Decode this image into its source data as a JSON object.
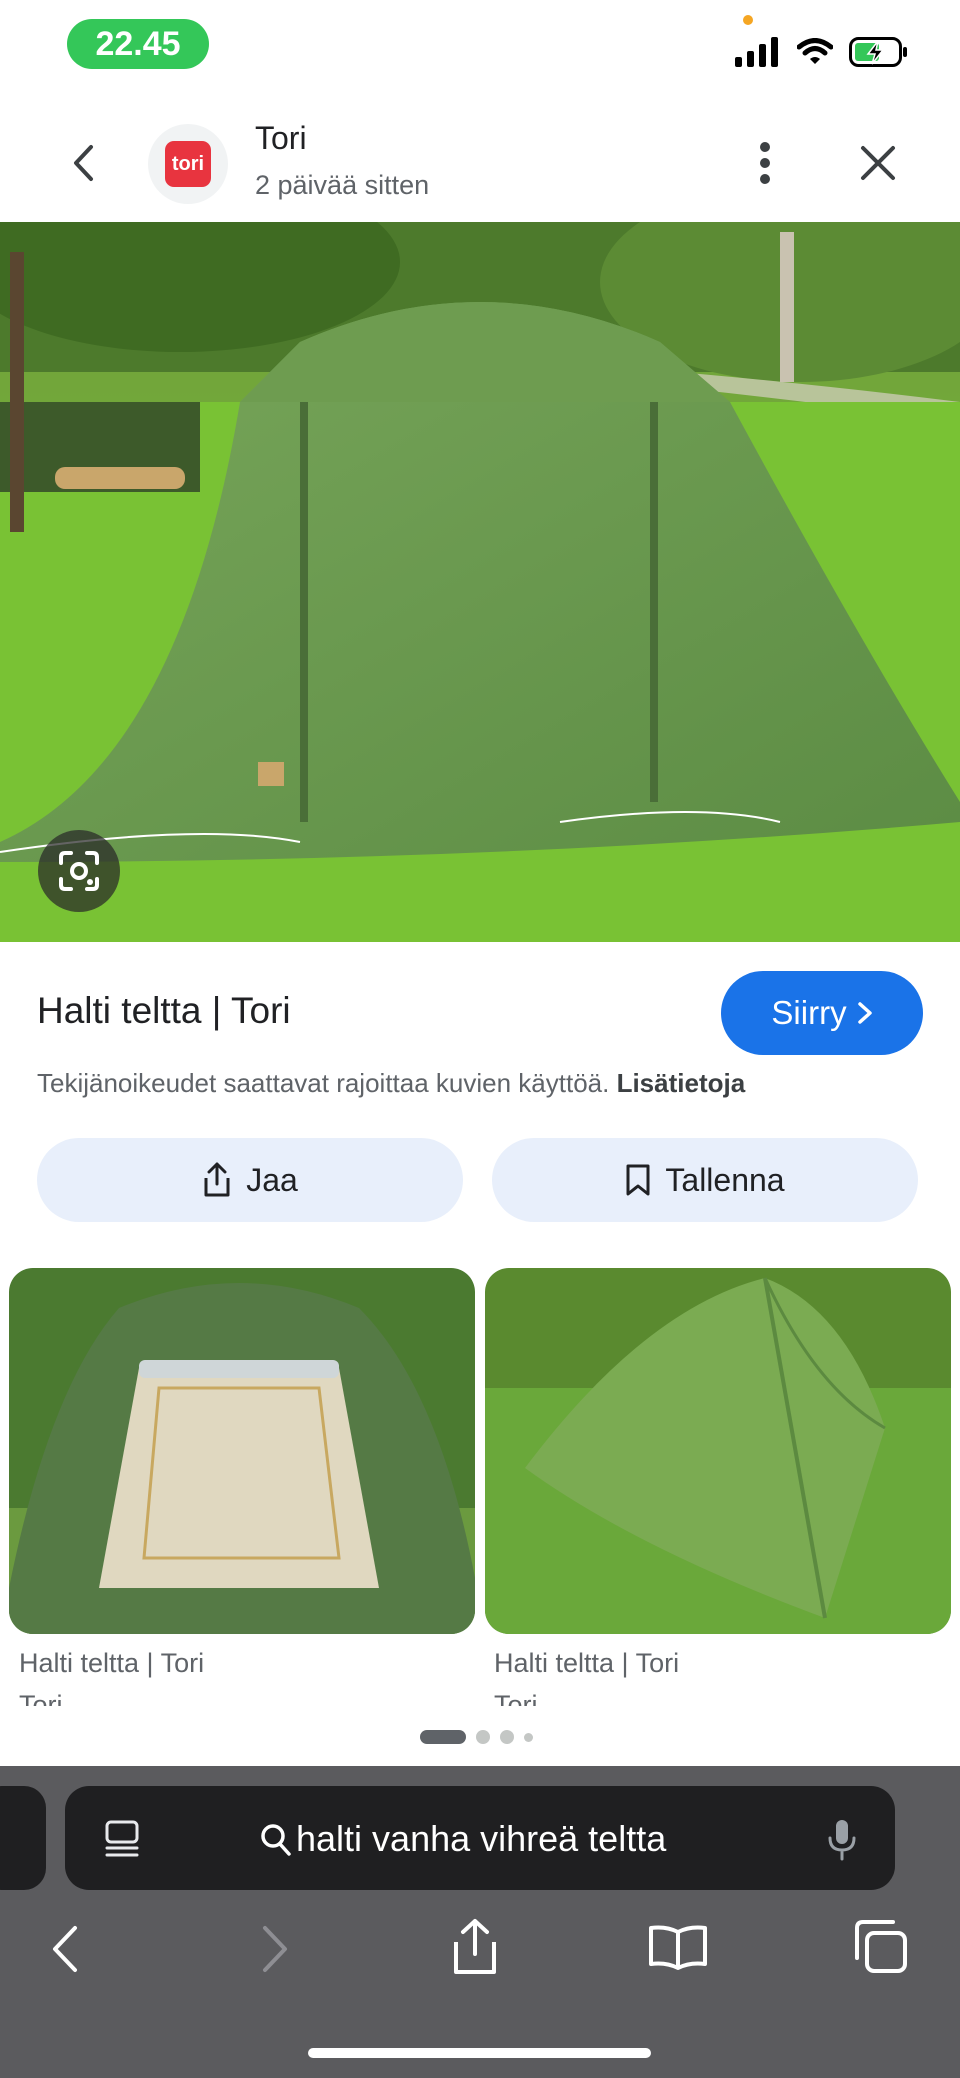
{
  "status_bar": {
    "time": "22.45"
  },
  "header": {
    "source_name": "Tori",
    "posted": "2 päivää sitten",
    "logo_text": "tori"
  },
  "result": {
    "title": "Halti teltta | Tori",
    "visit_label": "Siirry",
    "copyright_text": "Tekijänoikeudet saattavat rajoittaa kuvien käyttöä.",
    "more_info_link": "Lisätietoja",
    "share_label": "Jaa",
    "save_label": "Tallenna"
  },
  "related": [
    {
      "title": "Halti teltta | Tori",
      "source": "Tori"
    },
    {
      "title": "Halti teltta | Tori",
      "source": "Tori"
    }
  ],
  "browser": {
    "search_query": "halti vanha vihreä teltta"
  },
  "colors": {
    "accent": "#1a73e8",
    "status_green": "#34c759",
    "brand_red": "#e8343f",
    "chrome_bg": "#5b5b5e"
  }
}
